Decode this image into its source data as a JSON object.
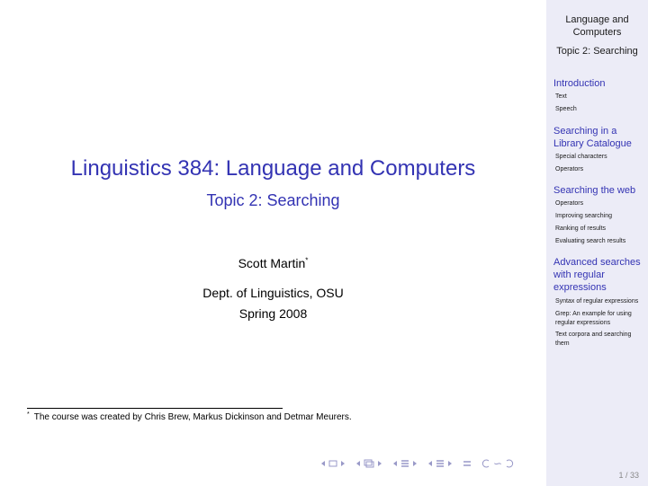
{
  "sidebar": {
    "header_line1": "Language and",
    "header_line2": "Computers",
    "topic": "Topic 2: Searching",
    "sections": [
      {
        "label": "Introduction",
        "subsections": [
          "Text",
          "Speech"
        ]
      },
      {
        "label_line1": "Searching in a",
        "label_line2": "Library Catalogue",
        "subsections": [
          "Special characters",
          "Operators"
        ]
      },
      {
        "label": "Searching the web",
        "subsections": [
          "Operators",
          "Improving searching",
          "Ranking of results",
          "Evaluating search results"
        ]
      },
      {
        "label_line1": "Advanced searches",
        "label_line2": "with regular",
        "label_line3": "expressions",
        "subsections": [
          "Syntax of regular expressions",
          "Grep: An example for using",
          "regular expressions",
          "Text corpora and searching",
          "them"
        ]
      }
    ]
  },
  "slide": {
    "title": "Linguistics 384: Language and Computers",
    "subtitle": "Topic 2: Searching",
    "author": "Scott Martin",
    "author_mark": "*",
    "affiliation": "Dept. of Linguistics, OSU",
    "date": "Spring 2008",
    "footnote_mark": "*",
    "footnote": "The course was created by Chris Brew, Markus Dickinson and Detmar Meurers."
  },
  "navigation": {
    "search_symbol": "∽",
    "page_number": "1 / 33",
    "nav_color": "#9999c8"
  },
  "colors": {
    "accent": "#3333b3",
    "sidebar_bg": "#ececf7"
  }
}
